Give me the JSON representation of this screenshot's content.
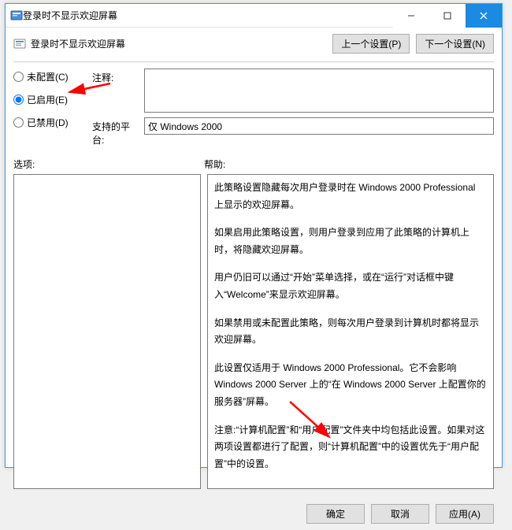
{
  "window": {
    "title": "登录时不显示欢迎屏幕"
  },
  "header": {
    "title": "登录时不显示欢迎屏幕",
    "prev_button": "上一个设置(P)",
    "next_button": "下一个设置(N)"
  },
  "radios": {
    "not_configured": "未配置(C)",
    "enabled": "已启用(E)",
    "disabled": "已禁用(D)",
    "selected": "enabled"
  },
  "comment": {
    "label": "注释:",
    "value": ""
  },
  "platform": {
    "label": "支持的平台:",
    "value": "仅 Windows 2000"
  },
  "sections": {
    "options_label": "选项:",
    "help_label": "帮助:"
  },
  "help_paragraphs": [
    "此策略设置隐藏每次用户登录时在 Windows 2000 Professional 上显示的欢迎屏幕。",
    "如果启用此策略设置，则用户登录到应用了此策略的计算机上时，将隐藏欢迎屏幕。",
    "用户仍旧可以通过“开始”菜单选择，或在“运行”对话框中键入“Welcome”来显示欢迎屏幕。",
    "如果禁用或未配置此策略，则每次用户登录到计算机时都将显示欢迎屏幕。",
    "此设置仅适用于 Windows 2000 Professional。它不会影响 Windows 2000 Server 上的“在 Windows 2000 Server 上配置你的服务器”屏幕。",
    "注意:“计算机配置”和“用户配置”文件夹中均包括此设置。如果对这两项设置都进行了配置，则“计算机配置”中的设置优先于“用户配置”中的设置。"
  ],
  "footer": {
    "ok": "确定",
    "cancel": "取消",
    "apply": "应用(A)"
  }
}
